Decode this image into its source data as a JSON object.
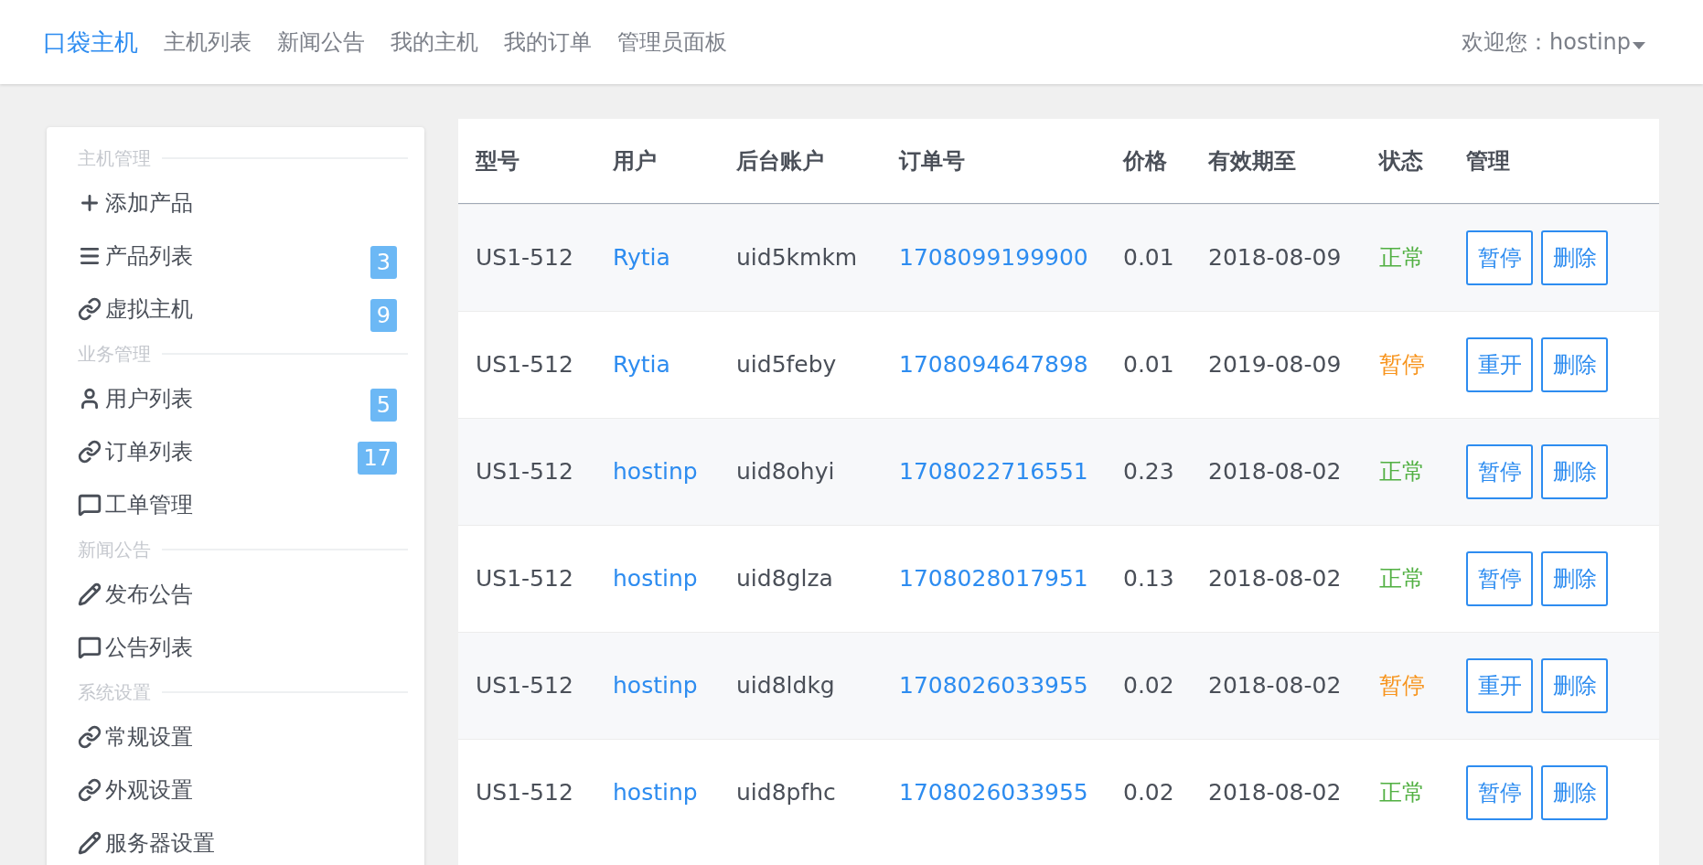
{
  "nav": {
    "brand": "口袋主机",
    "links": [
      "主机列表",
      "新闻公告",
      "我的主机",
      "我的订单",
      "管理员面板"
    ],
    "user": "欢迎您：hostinp"
  },
  "sidebar": {
    "sections": [
      {
        "title": "主机管理",
        "items": [
          {
            "label": "添加产品"
          },
          {
            "label": "产品列表",
            "badge": "3"
          },
          {
            "label": "虚拟主机",
            "badge": "9"
          }
        ]
      },
      {
        "title": "业务管理",
        "items": [
          {
            "label": "用户列表",
            "badge": "5"
          },
          {
            "label": "订单列表",
            "badge": "17"
          },
          {
            "label": "工单管理"
          }
        ]
      },
      {
        "title": "新闻公告",
        "items": [
          {
            "label": "发布公告"
          },
          {
            "label": "公告列表"
          }
        ]
      },
      {
        "title": "系统设置",
        "items": [
          {
            "label": "常规设置"
          },
          {
            "label": "外观设置"
          },
          {
            "label": "服务器设置"
          }
        ]
      }
    ]
  },
  "table": {
    "columns": [
      "型号",
      "用户",
      "后台账户",
      "订单号",
      "价格",
      "有效期至",
      "状态",
      "管理"
    ],
    "rows": [
      {
        "model": "US1-512",
        "user": "Rytia",
        "account": "uid5kmkm",
        "order": "1708099199900",
        "price": "0.01",
        "expiry": "2018-08-09",
        "status": {
          "text": "正常",
          "kind": "active"
        },
        "actions": [
          "暂停",
          "删除"
        ]
      },
      {
        "model": "US1-512",
        "user": "Rytia",
        "account": "uid5feby",
        "order": "1708094647898",
        "price": "0.01",
        "expiry": "2019-08-09",
        "status": {
          "text": "暂停",
          "kind": "suspended"
        },
        "actions": [
          "重开",
          "删除"
        ]
      },
      {
        "model": "US1-512",
        "user": "hostinp",
        "account": "uid8ohyi",
        "order": "1708022716551",
        "price": "0.23",
        "expiry": "2018-08-02",
        "status": {
          "text": "正常",
          "kind": "active"
        },
        "actions": [
          "暂停",
          "删除"
        ]
      },
      {
        "model": "US1-512",
        "user": "hostinp",
        "account": "uid8glza",
        "order": "1708028017951",
        "price": "0.13",
        "expiry": "2018-08-02",
        "status": {
          "text": "正常",
          "kind": "active"
        },
        "actions": [
          "暂停",
          "删除"
        ]
      },
      {
        "model": "US1-512",
        "user": "hostinp",
        "account": "uid8ldkg",
        "order": "1708026033955",
        "price": "0.02",
        "expiry": "2018-08-02",
        "status": {
          "text": "暂停",
          "kind": "suspended"
        },
        "actions": [
          "重开",
          "删除"
        ]
      },
      {
        "model": "US1-512",
        "user": "hostinp",
        "account": "uid8pfhc",
        "order": "1708026033955",
        "price": "0.02",
        "expiry": "2018-08-02",
        "status": {
          "text": "正常",
          "kind": "active"
        },
        "actions": [
          "暂停",
          "删除"
        ]
      }
    ]
  }
}
